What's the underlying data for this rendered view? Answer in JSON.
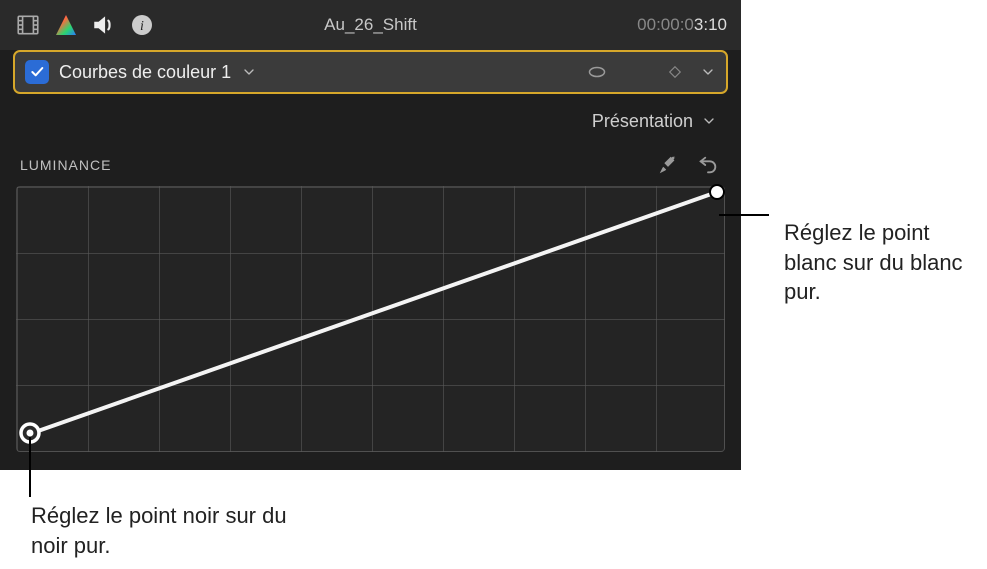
{
  "header": {
    "clip_title": "Au_26_Shift",
    "timecode_dim": "00:00:0",
    "timecode_bright": "3:10"
  },
  "effect": {
    "checked": true,
    "name_label": "Courbes de couleur 1"
  },
  "view": {
    "label": "Présentation"
  },
  "curve": {
    "title": "LUMINANCE"
  },
  "callouts": {
    "white": "Réglez le point blanc sur du blanc pur.",
    "black": "Réglez le point noir sur du noir pur."
  },
  "icons": {
    "film": "film-icon",
    "color": "color-icon",
    "volume": "volume-icon",
    "info": "info-icon",
    "mask": "mask-icon",
    "keyframe": "keyframe-icon",
    "chevron_down": "chevron-down-icon",
    "eyedropper": "eyedropper-icon",
    "reset": "reset-icon"
  },
  "chart_data": {
    "type": "line",
    "title": "LUMINANCE",
    "x": [
      0,
      1
    ],
    "values": [
      0,
      1
    ],
    "xlabel": "",
    "ylabel": "",
    "xlim": [
      0,
      1
    ],
    "ylim": [
      0,
      1
    ],
    "points": [
      {
        "x": 0.0,
        "y": 0.0,
        "name": "black-point"
      },
      {
        "x": 1.0,
        "y": 1.0,
        "name": "white-point"
      }
    ]
  }
}
